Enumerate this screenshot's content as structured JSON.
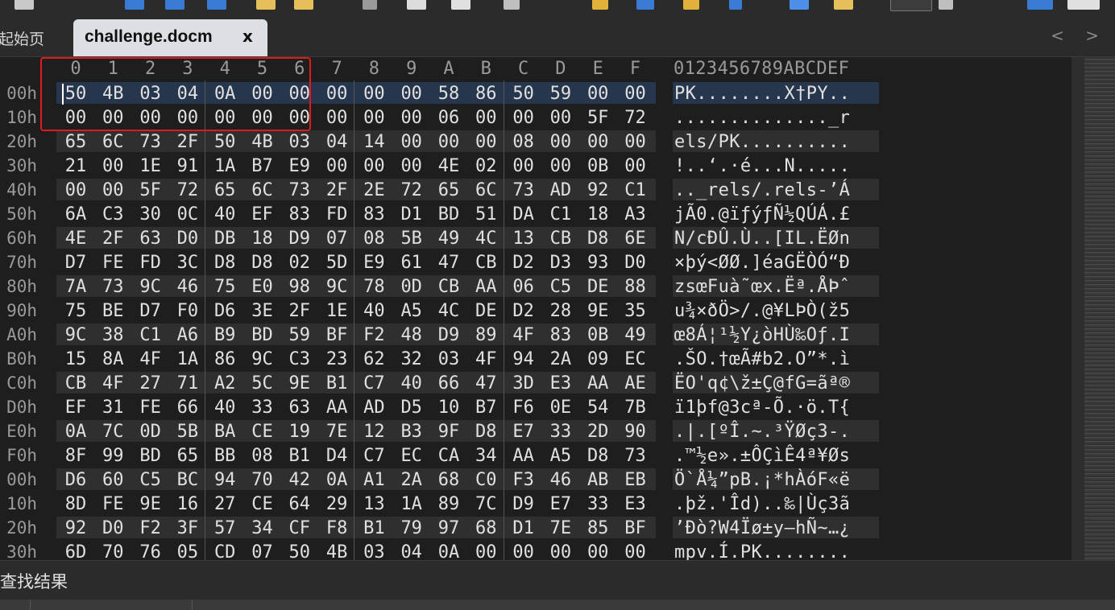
{
  "tabs": {
    "start_page": "起始页",
    "active": "challenge.docm",
    "close_glyph": "x",
    "nav": "< >"
  },
  "hex_view": {
    "column_labels": [
      "0",
      "1",
      "2",
      "3",
      "4",
      "5",
      "6",
      "7",
      "8",
      "9",
      "A",
      "B",
      "C",
      "D",
      "E",
      "F"
    ],
    "ascii_header": "0123456789ABCDEF",
    "rows": [
      {
        "offset": "00h",
        "bytes": [
          "50",
          "4B",
          "03",
          "04",
          "0A",
          "00",
          "00",
          "00",
          "00",
          "00",
          "58",
          "86",
          "50",
          "59",
          "00",
          "00"
        ],
        "ascii": "PK........X†PY.."
      },
      {
        "offset": "10h",
        "bytes": [
          "00",
          "00",
          "00",
          "00",
          "00",
          "00",
          "00",
          "00",
          "00",
          "00",
          "06",
          "00",
          "00",
          "00",
          "5F",
          "72"
        ],
        "ascii": ".............._r"
      },
      {
        "offset": "20h",
        "bytes": [
          "65",
          "6C",
          "73",
          "2F",
          "50",
          "4B",
          "03",
          "04",
          "14",
          "00",
          "00",
          "00",
          "08",
          "00",
          "00",
          "00"
        ],
        "ascii": "els/PK.........."
      },
      {
        "offset": "30h",
        "bytes": [
          "21",
          "00",
          "1E",
          "91",
          "1A",
          "B7",
          "E9",
          "00",
          "00",
          "00",
          "4E",
          "02",
          "00",
          "00",
          "0B",
          "00"
        ],
        "ascii": "!..‘.·é...N....."
      },
      {
        "offset": "40h",
        "bytes": [
          "00",
          "00",
          "5F",
          "72",
          "65",
          "6C",
          "73",
          "2F",
          "2E",
          "72",
          "65",
          "6C",
          "73",
          "AD",
          "92",
          "C1"
        ],
        "ascii": ".._rels/.rels-’Á"
      },
      {
        "offset": "50h",
        "bytes": [
          "6A",
          "C3",
          "30",
          "0C",
          "40",
          "EF",
          "83",
          "FD",
          "83",
          "D1",
          "BD",
          "51",
          "DA",
          "C1",
          "18",
          "A3"
        ],
        "ascii": "jÃ0.@ïƒýƒÑ½QÚÁ.£"
      },
      {
        "offset": "60h",
        "bytes": [
          "4E",
          "2F",
          "63",
          "D0",
          "DB",
          "18",
          "D9",
          "07",
          "08",
          "5B",
          "49",
          "4C",
          "13",
          "CB",
          "D8",
          "6E"
        ],
        "ascii": "N/cÐÛ.Ù..[IL.ËØn"
      },
      {
        "offset": "70h",
        "bytes": [
          "D7",
          "FE",
          "FD",
          "3C",
          "D8",
          "D8",
          "02",
          "5D",
          "E9",
          "61",
          "47",
          "CB",
          "D2",
          "D3",
          "93",
          "D0"
        ],
        "ascii": "×þý<ØØ.]éaGËÒÓ“Ð"
      },
      {
        "offset": "80h",
        "bytes": [
          "7A",
          "73",
          "9C",
          "46",
          "75",
          "E0",
          "98",
          "9C",
          "78",
          "0D",
          "CB",
          "AA",
          "06",
          "C5",
          "DE",
          "88"
        ],
        "ascii": "zsœFuà˜œx.Ëª.ÅÞˆ"
      },
      {
        "offset": "90h",
        "bytes": [
          "75",
          "BE",
          "D7",
          "F0",
          "D6",
          "3E",
          "2F",
          "1E",
          "40",
          "A5",
          "4C",
          "DE",
          "D2",
          "28",
          "9E",
          "35"
        ],
        "ascii": "u¾×ðÖ>/.@¥LÞÒ(ž5"
      },
      {
        "offset": "A0h",
        "bytes": [
          "9C",
          "38",
          "C1",
          "A6",
          "B9",
          "BD",
          "59",
          "BF",
          "F2",
          "48",
          "D9",
          "89",
          "4F",
          "83",
          "0B",
          "49"
        ],
        "ascii": "œ8Á¦¹½Y¿òHÙ‰Oƒ.I"
      },
      {
        "offset": "B0h",
        "bytes": [
          "15",
          "8A",
          "4F",
          "1A",
          "86",
          "9C",
          "C3",
          "23",
          "62",
          "32",
          "03",
          "4F",
          "94",
          "2A",
          "09",
          "EC"
        ],
        "ascii": ".ŠO.†œÃ#b2.O”*.ì"
      },
      {
        "offset": "C0h",
        "bytes": [
          "CB",
          "4F",
          "27",
          "71",
          "A2",
          "5C",
          "9E",
          "B1",
          "C7",
          "40",
          "66",
          "47",
          "3D",
          "E3",
          "AA",
          "AE"
        ],
        "ascii": "ËO'q¢\\ž±Ç@fG=ãª®"
      },
      {
        "offset": "D0h",
        "bytes": [
          "EF",
          "31",
          "FE",
          "66",
          "40",
          "33",
          "63",
          "AA",
          "AD",
          "D5",
          "10",
          "B7",
          "F6",
          "0E",
          "54",
          "7B"
        ],
        "ascii": "ï1þf@3cª-Õ.·ö.T{"
      },
      {
        "offset": "E0h",
        "bytes": [
          "0A",
          "7C",
          "0D",
          "5B",
          "BA",
          "CE",
          "19",
          "7E",
          "12",
          "B3",
          "9F",
          "D8",
          "E7",
          "33",
          "2D",
          "90"
        ],
        "ascii": ".|.[ºÎ.~.³ŸØç3-."
      },
      {
        "offset": "F0h",
        "bytes": [
          "8F",
          "99",
          "BD",
          "65",
          "BB",
          "08",
          "B1",
          "D4",
          "C7",
          "EC",
          "CA",
          "34",
          "AA",
          "A5",
          "D8",
          "73"
        ],
        "ascii": ".™½e».±ÔÇìÊ4ª¥Øs"
      },
      {
        "offset": "00h",
        "bytes": [
          "D6",
          "60",
          "C5",
          "BC",
          "94",
          "70",
          "42",
          "0A",
          "A1",
          "2A",
          "68",
          "C0",
          "F3",
          "46",
          "AB",
          "EB"
        ],
        "ascii": "Ö`Å¼”pB.¡*hÀóF«ë"
      },
      {
        "offset": "10h",
        "bytes": [
          "8D",
          "FE",
          "9E",
          "16",
          "27",
          "CE",
          "64",
          "29",
          "13",
          "1A",
          "89",
          "7C",
          "D9",
          "E7",
          "33",
          "E3"
        ],
        "ascii": ".þž.'Îd)..‰|Ùç3ã"
      },
      {
        "offset": "20h",
        "bytes": [
          "92",
          "D0",
          "F2",
          "3F",
          "57",
          "34",
          "CF",
          "F8",
          "B1",
          "79",
          "97",
          "68",
          "D1",
          "7E",
          "85",
          "BF"
        ],
        "ascii": "’Ðò?W4Ïø±y—hÑ~…¿"
      },
      {
        "offset": "30h",
        "bytes": [
          "6D",
          "70",
          "76",
          "05",
          "CD",
          "07",
          "50",
          "4B",
          "03",
          "04",
          "0A",
          "00",
          "00",
          "00",
          "00",
          "00"
        ],
        "ascii": "mpv.Í.PK........"
      }
    ]
  },
  "bottom_panel": {
    "title": "查找结果"
  },
  "colors": {
    "highlight_box": "#e11b1b",
    "selection": "#26364d",
    "alt_row": "#2f2f2f",
    "active_tab": "#dcdfe3"
  },
  "icons": [
    "save-icon",
    "save-all-icon",
    "copy-icon",
    "paste-icon",
    "cut-icon",
    "search-icon",
    "replace-icon",
    "font-icon",
    "hex-icon"
  ]
}
